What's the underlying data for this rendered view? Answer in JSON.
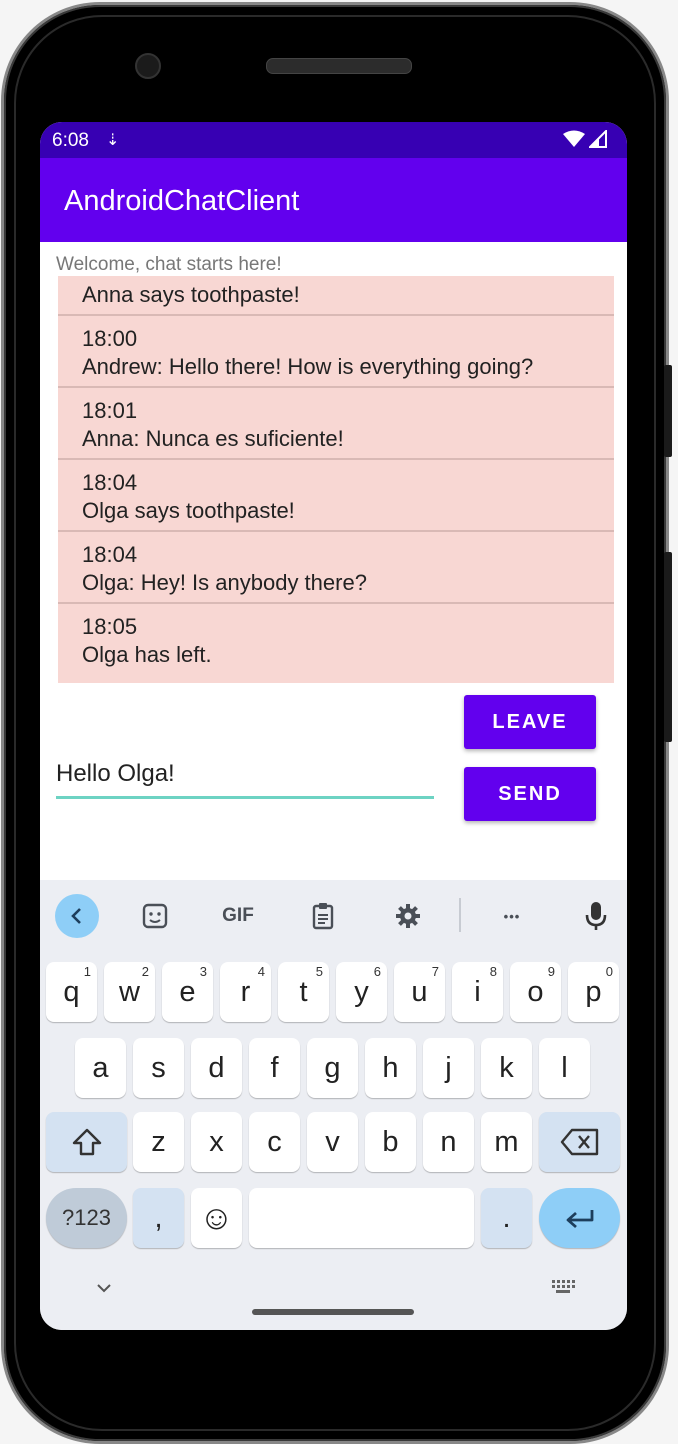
{
  "status": {
    "time": "6:08",
    "download_glyph": "⇣"
  },
  "app": {
    "title": "AndroidChatClient"
  },
  "chat": {
    "welcome": "Welcome, chat starts here!",
    "first_message": "Anna says toothpaste!",
    "messages": [
      {
        "time": "18:00",
        "text": "Andrew: Hello there! How is everything going?"
      },
      {
        "time": "18:01",
        "text": "Anna: Nunca es suficiente!"
      },
      {
        "time": "18:04",
        "text": "Olga says toothpaste!"
      },
      {
        "time": "18:04",
        "text": "Olga: Hey! Is anybody there?"
      },
      {
        "time": "18:05",
        "text": "Olga has left."
      }
    ]
  },
  "actions": {
    "leave_label": "LEAVE",
    "send_label": "SEND"
  },
  "composer": {
    "value": "Hello Olga!"
  },
  "keyboard": {
    "toolbar": {
      "gif_label": "GIF",
      "more_label": "•••"
    },
    "row1": [
      "q",
      "w",
      "e",
      "r",
      "t",
      "y",
      "u",
      "i",
      "o",
      "p"
    ],
    "row1_hints": [
      "1",
      "2",
      "3",
      "4",
      "5",
      "6",
      "7",
      "8",
      "9",
      "0"
    ],
    "row2": [
      "a",
      "s",
      "d",
      "f",
      "g",
      "h",
      "j",
      "k",
      "l"
    ],
    "row3": [
      "z",
      "x",
      "c",
      "v",
      "b",
      "n",
      "m"
    ],
    "sym_label": "?123",
    "comma": ",",
    "period": ".",
    "emoji_glyph": "☺",
    "nav_down_glyph": "⌄"
  },
  "colors": {
    "primary": "#6200ee",
    "primary_dark": "#3700b3",
    "message_bg": "#f8d7d3",
    "input_underline": "#6dd3c3"
  }
}
